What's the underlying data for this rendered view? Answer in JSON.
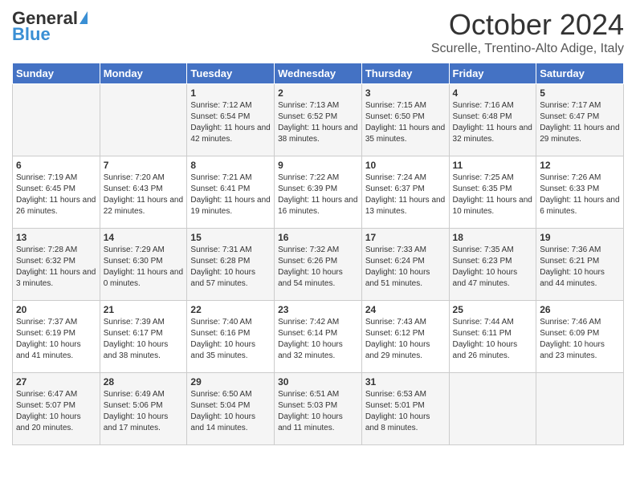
{
  "header": {
    "logo_general": "General",
    "logo_blue": "Blue",
    "month": "October 2024",
    "location": "Scurelle, Trentino-Alto Adige, Italy"
  },
  "days_of_week": [
    "Sunday",
    "Monday",
    "Tuesday",
    "Wednesday",
    "Thursday",
    "Friday",
    "Saturday"
  ],
  "weeks": [
    [
      {
        "day": "",
        "sunrise": "",
        "sunset": "",
        "daylight": ""
      },
      {
        "day": "",
        "sunrise": "",
        "sunset": "",
        "daylight": ""
      },
      {
        "day": "1",
        "sunrise": "Sunrise: 7:12 AM",
        "sunset": "Sunset: 6:54 PM",
        "daylight": "Daylight: 11 hours and 42 minutes."
      },
      {
        "day": "2",
        "sunrise": "Sunrise: 7:13 AM",
        "sunset": "Sunset: 6:52 PM",
        "daylight": "Daylight: 11 hours and 38 minutes."
      },
      {
        "day": "3",
        "sunrise": "Sunrise: 7:15 AM",
        "sunset": "Sunset: 6:50 PM",
        "daylight": "Daylight: 11 hours and 35 minutes."
      },
      {
        "day": "4",
        "sunrise": "Sunrise: 7:16 AM",
        "sunset": "Sunset: 6:48 PM",
        "daylight": "Daylight: 11 hours and 32 minutes."
      },
      {
        "day": "5",
        "sunrise": "Sunrise: 7:17 AM",
        "sunset": "Sunset: 6:47 PM",
        "daylight": "Daylight: 11 hours and 29 minutes."
      }
    ],
    [
      {
        "day": "6",
        "sunrise": "Sunrise: 7:19 AM",
        "sunset": "Sunset: 6:45 PM",
        "daylight": "Daylight: 11 hours and 26 minutes."
      },
      {
        "day": "7",
        "sunrise": "Sunrise: 7:20 AM",
        "sunset": "Sunset: 6:43 PM",
        "daylight": "Daylight: 11 hours and 22 minutes."
      },
      {
        "day": "8",
        "sunrise": "Sunrise: 7:21 AM",
        "sunset": "Sunset: 6:41 PM",
        "daylight": "Daylight: 11 hours and 19 minutes."
      },
      {
        "day": "9",
        "sunrise": "Sunrise: 7:22 AM",
        "sunset": "Sunset: 6:39 PM",
        "daylight": "Daylight: 11 hours and 16 minutes."
      },
      {
        "day": "10",
        "sunrise": "Sunrise: 7:24 AM",
        "sunset": "Sunset: 6:37 PM",
        "daylight": "Daylight: 11 hours and 13 minutes."
      },
      {
        "day": "11",
        "sunrise": "Sunrise: 7:25 AM",
        "sunset": "Sunset: 6:35 PM",
        "daylight": "Daylight: 11 hours and 10 minutes."
      },
      {
        "day": "12",
        "sunrise": "Sunrise: 7:26 AM",
        "sunset": "Sunset: 6:33 PM",
        "daylight": "Daylight: 11 hours and 6 minutes."
      }
    ],
    [
      {
        "day": "13",
        "sunrise": "Sunrise: 7:28 AM",
        "sunset": "Sunset: 6:32 PM",
        "daylight": "Daylight: 11 hours and 3 minutes."
      },
      {
        "day": "14",
        "sunrise": "Sunrise: 7:29 AM",
        "sunset": "Sunset: 6:30 PM",
        "daylight": "Daylight: 11 hours and 0 minutes."
      },
      {
        "day": "15",
        "sunrise": "Sunrise: 7:31 AM",
        "sunset": "Sunset: 6:28 PM",
        "daylight": "Daylight: 10 hours and 57 minutes."
      },
      {
        "day": "16",
        "sunrise": "Sunrise: 7:32 AM",
        "sunset": "Sunset: 6:26 PM",
        "daylight": "Daylight: 10 hours and 54 minutes."
      },
      {
        "day": "17",
        "sunrise": "Sunrise: 7:33 AM",
        "sunset": "Sunset: 6:24 PM",
        "daylight": "Daylight: 10 hours and 51 minutes."
      },
      {
        "day": "18",
        "sunrise": "Sunrise: 7:35 AM",
        "sunset": "Sunset: 6:23 PM",
        "daylight": "Daylight: 10 hours and 47 minutes."
      },
      {
        "day": "19",
        "sunrise": "Sunrise: 7:36 AM",
        "sunset": "Sunset: 6:21 PM",
        "daylight": "Daylight: 10 hours and 44 minutes."
      }
    ],
    [
      {
        "day": "20",
        "sunrise": "Sunrise: 7:37 AM",
        "sunset": "Sunset: 6:19 PM",
        "daylight": "Daylight: 10 hours and 41 minutes."
      },
      {
        "day": "21",
        "sunrise": "Sunrise: 7:39 AM",
        "sunset": "Sunset: 6:17 PM",
        "daylight": "Daylight: 10 hours and 38 minutes."
      },
      {
        "day": "22",
        "sunrise": "Sunrise: 7:40 AM",
        "sunset": "Sunset: 6:16 PM",
        "daylight": "Daylight: 10 hours and 35 minutes."
      },
      {
        "day": "23",
        "sunrise": "Sunrise: 7:42 AM",
        "sunset": "Sunset: 6:14 PM",
        "daylight": "Daylight: 10 hours and 32 minutes."
      },
      {
        "day": "24",
        "sunrise": "Sunrise: 7:43 AM",
        "sunset": "Sunset: 6:12 PM",
        "daylight": "Daylight: 10 hours and 29 minutes."
      },
      {
        "day": "25",
        "sunrise": "Sunrise: 7:44 AM",
        "sunset": "Sunset: 6:11 PM",
        "daylight": "Daylight: 10 hours and 26 minutes."
      },
      {
        "day": "26",
        "sunrise": "Sunrise: 7:46 AM",
        "sunset": "Sunset: 6:09 PM",
        "daylight": "Daylight: 10 hours and 23 minutes."
      }
    ],
    [
      {
        "day": "27",
        "sunrise": "Sunrise: 6:47 AM",
        "sunset": "Sunset: 5:07 PM",
        "daylight": "Daylight: 10 hours and 20 minutes."
      },
      {
        "day": "28",
        "sunrise": "Sunrise: 6:49 AM",
        "sunset": "Sunset: 5:06 PM",
        "daylight": "Daylight: 10 hours and 17 minutes."
      },
      {
        "day": "29",
        "sunrise": "Sunrise: 6:50 AM",
        "sunset": "Sunset: 5:04 PM",
        "daylight": "Daylight: 10 hours and 14 minutes."
      },
      {
        "day": "30",
        "sunrise": "Sunrise: 6:51 AM",
        "sunset": "Sunset: 5:03 PM",
        "daylight": "Daylight: 10 hours and 11 minutes."
      },
      {
        "day": "31",
        "sunrise": "Sunrise: 6:53 AM",
        "sunset": "Sunset: 5:01 PM",
        "daylight": "Daylight: 10 hours and 8 minutes."
      },
      {
        "day": "",
        "sunrise": "",
        "sunset": "",
        "daylight": ""
      },
      {
        "day": "",
        "sunrise": "",
        "sunset": "",
        "daylight": ""
      }
    ]
  ]
}
